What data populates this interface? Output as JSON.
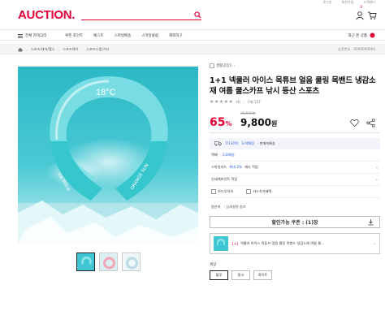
{
  "header": {
    "logo": "AUCTION.",
    "search_placeholder": "",
    "util_links": [
      "로그인",
      "회원가입",
      "고객센터"
    ],
    "cart_badge": "0",
    "util_link_label": "로그인"
  },
  "nav": {
    "category_label": "전체 카테고리",
    "items": [
      "쿠폰·포인트",
      "베스트",
      "스마일배송",
      "스마일클럽",
      "해외직구"
    ],
    "recent_label": "최근 본 상품"
  },
  "breadcrumb": {
    "items": [
      "스포츠/레저/헬스",
      "스포츠웨어",
      "스포츠소품/기타"
    ],
    "order_no": "상품번호 : 0000000000"
  },
  "product": {
    "store": "생활공장1",
    "title": "1+1 넥쿨러 아이스 목튜브 얼음 쿨링 목밴드 냉감소재 여름 쿨스카프 낚시 등산 스포츠",
    "stars": "★★★★★",
    "review_count": "(4)",
    "purchase_label": "구매 157",
    "original_price": "28,600원",
    "discount_pct": "65",
    "pct_unit": "%",
    "price": "9,800",
    "price_unit": "원",
    "image_temp_text": "18°C",
    "image_band_text_left": "Ice Pillow",
    "image_band_text_right": "ORANGE SUN"
  },
  "delivery": {
    "date_text": "7/13(목)",
    "arrive_text": "도착예정",
    "extra_text": "· 판매자배송"
  },
  "rows": {
    "shipping_label": "택배",
    "shipping_value": "· 무료배송",
    "smilepay_label": "스마일카드",
    "smilepay_value": "최대 2%",
    "smilepay_tail": "캐시 적립",
    "card_point_label": "신세계포인트 적립",
    "card_installment": "카드무이자",
    "card_extra": "카드추가혜택",
    "option_label": "원산지",
    "option_value": ": 상세설명 참조"
  },
  "coupon": {
    "label": "할인가능 쿠폰 : (1)장"
  },
  "bundle": {
    "tag": "1+1",
    "text": "넥쿨러 아이스 목튜브 얼음 쿨링 목밴드 냉감소재 여름 쿨..."
  },
  "colors": {
    "label": "색상",
    "options": [
      "블루",
      "핑크",
      "화이트"
    ],
    "selected": "블루"
  },
  "palette": {
    "brand": "#e5003a",
    "link_blue": "#2a5bd7",
    "image_bg": "#3ec7d2"
  },
  "icons": [
    "search-icon",
    "cart-icon",
    "user-icon",
    "menu-icon",
    "store-icon",
    "heart-icon",
    "share-icon",
    "truck-icon",
    "download-icon",
    "chevron-right-icon"
  ]
}
